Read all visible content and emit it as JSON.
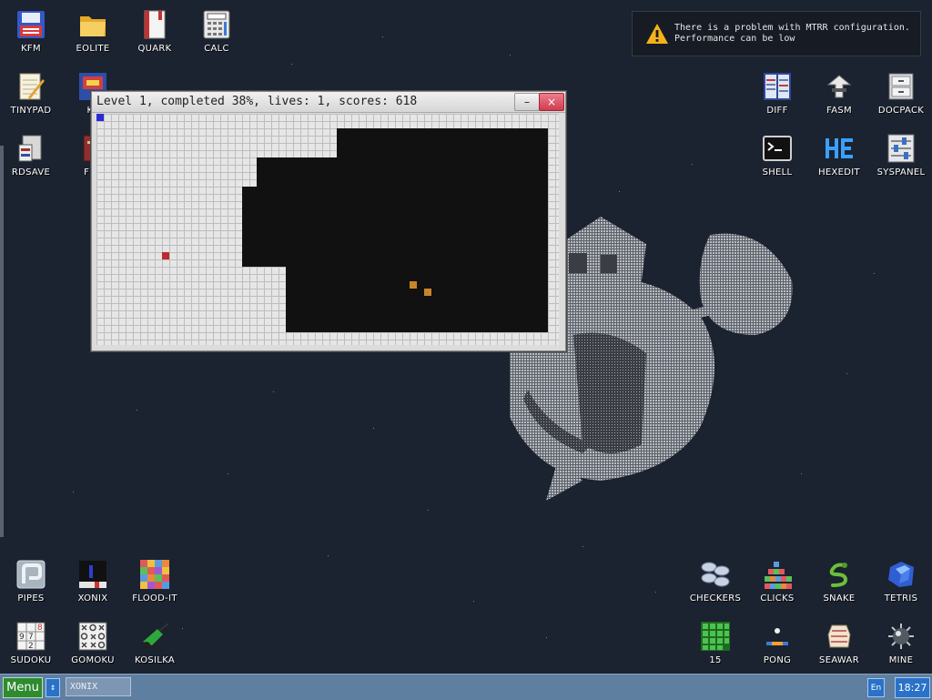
{
  "notification": {
    "line1": "There is a problem with MTRR configuration.",
    "line2": "Performance can be low",
    "icon": "warning-icon",
    "accent_color": "#f2b21c"
  },
  "desktop_icons_top_left": [
    {
      "label": "KFM",
      "icon": "floppy-disk-icon"
    },
    {
      "label": "EOLITE",
      "icon": "folder-icon"
    },
    {
      "label": "QUARK",
      "icon": "book-icon"
    },
    {
      "label": "CALC",
      "icon": "calculator-icon"
    },
    {
      "label": "TINYPAD",
      "icon": "notepad-icon"
    },
    {
      "label": "KF",
      "icon": "image-viewer-icon"
    },
    {
      "label": "RDSAVE",
      "icon": "disk-save-icon"
    },
    {
      "label": "FB2",
      "icon": "ebook-icon"
    }
  ],
  "desktop_icons_top_right": [
    {
      "label": "DIFF",
      "icon": "diff-icon"
    },
    {
      "label": "FASM",
      "icon": "assembler-icon"
    },
    {
      "label": "DOCPACK",
      "icon": "cabinet-icon"
    },
    {
      "label": "SHELL",
      "icon": "terminal-icon"
    },
    {
      "label": "HEXEDIT",
      "icon": "hexedit-icon"
    },
    {
      "label": "SYSPANEL",
      "icon": "sliders-icon"
    }
  ],
  "desktop_icons_bottom_left": [
    {
      "label": "PIPES",
      "icon": "pipes-icon"
    },
    {
      "label": "XONIX",
      "icon": "xonix-icon"
    },
    {
      "label": "FLOOD-IT",
      "icon": "flood-it-icon"
    },
    {
      "label": "SUDOKU",
      "icon": "sudoku-icon"
    },
    {
      "label": "GOMOKU",
      "icon": "gomoku-icon"
    },
    {
      "label": "KOSILKA",
      "icon": "lawnmower-icon"
    }
  ],
  "desktop_icons_bottom_right": [
    {
      "label": "CHECKERS",
      "icon": "checkers-icon"
    },
    {
      "label": "CLICKS",
      "icon": "clicks-icon"
    },
    {
      "label": "SNAKE",
      "icon": "snake-icon"
    },
    {
      "label": "TETRIS",
      "icon": "tetris-icon"
    },
    {
      "label": "15",
      "icon": "fifteen-puzzle-icon"
    },
    {
      "label": "PONG",
      "icon": "pong-icon"
    },
    {
      "label": "SEAWAR",
      "icon": "battleship-icon"
    },
    {
      "label": "MINE",
      "icon": "mine-icon"
    }
  ],
  "game_window": {
    "title": "Level 1, completed 38%, lives: 1, scores: 618",
    "minimize_label": "–",
    "close_label": "×",
    "colors": {
      "filled": "#e6e6e6",
      "void": "#111111",
      "player": "#2b2bd6",
      "land_enemy": "#c0282f",
      "sea_enemy": "#c8862a"
    }
  },
  "taskbar": {
    "menu_label": "Menu",
    "switch_label": "↕",
    "task_item": "XONIX",
    "language": "En",
    "clock": "18:27"
  }
}
